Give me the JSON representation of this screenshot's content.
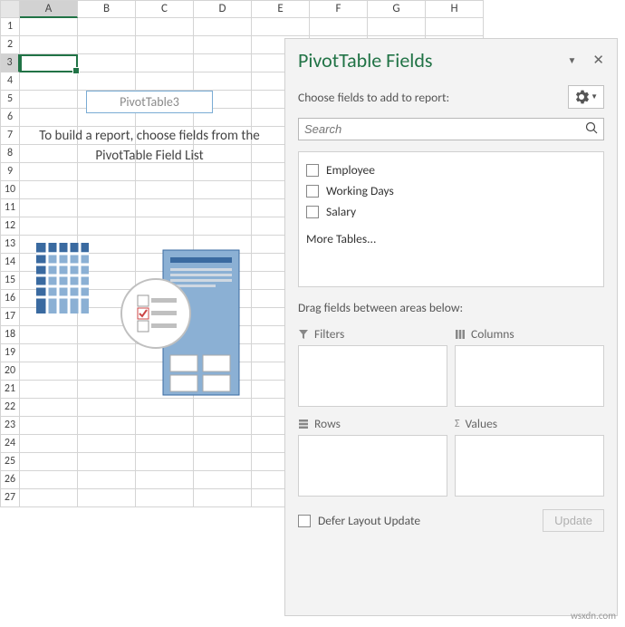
{
  "columns": [
    "A",
    "B",
    "C",
    "D",
    "E",
    "F",
    "G",
    "H"
  ],
  "rows": [
    1,
    2,
    3,
    4,
    5,
    6,
    7,
    8,
    9,
    10,
    11,
    12,
    13,
    14,
    15,
    16,
    17,
    18,
    19,
    20,
    21,
    22,
    23,
    24,
    25,
    26,
    27
  ],
  "active_cell": "A3",
  "pivot": {
    "name": "PivotTable3",
    "instruction": "To build a report, choose fields from the PivotTable Field List"
  },
  "pane": {
    "title": "PivotTable Fields",
    "choose_label": "Choose fields to add to report:",
    "search_placeholder": "Search",
    "fields": [
      {
        "label": "Employee",
        "checked": false
      },
      {
        "label": "Working Days",
        "checked": false
      },
      {
        "label": "Salary",
        "checked": false
      }
    ],
    "more_tables": "More Tables...",
    "drag_label": "Drag fields between areas below:",
    "areas": {
      "filters": "Filters",
      "columns": "Columns",
      "rows": "Rows",
      "values": "Values"
    },
    "defer_label": "Defer Layout Update",
    "update_label": "Update"
  },
  "watermark": "wsxdn.com"
}
